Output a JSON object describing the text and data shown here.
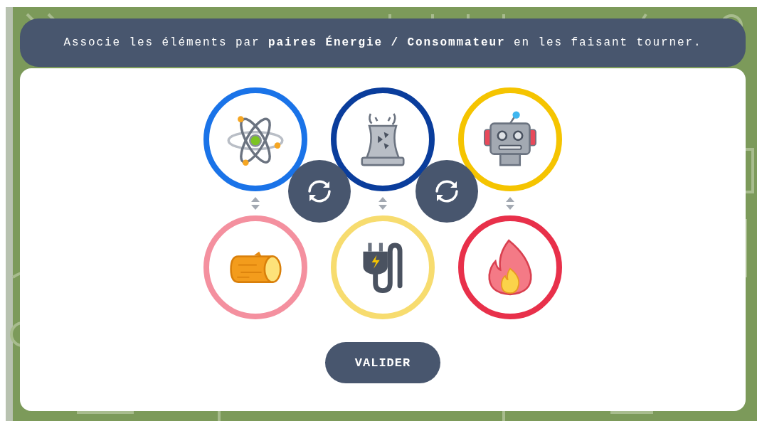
{
  "instruction": "Associe les éléments par **paires Énergie / Consommateur** en les faisant tourner.",
  "columns": [
    {
      "top": {
        "kind": "atom",
        "color": "#1a73e8"
      },
      "bottom": {
        "kind": "log",
        "color": "#f4909f"
      }
    },
    {
      "top": {
        "kind": "plant",
        "color": "#0a3d9c"
      },
      "bottom": {
        "kind": "plug",
        "color": "#f7dc6f"
      }
    },
    {
      "top": {
        "kind": "robot",
        "color": "#f5c400"
      },
      "bottom": {
        "kind": "fire",
        "color": "#e8304a"
      }
    }
  ],
  "submit_button": "VALIDER"
}
